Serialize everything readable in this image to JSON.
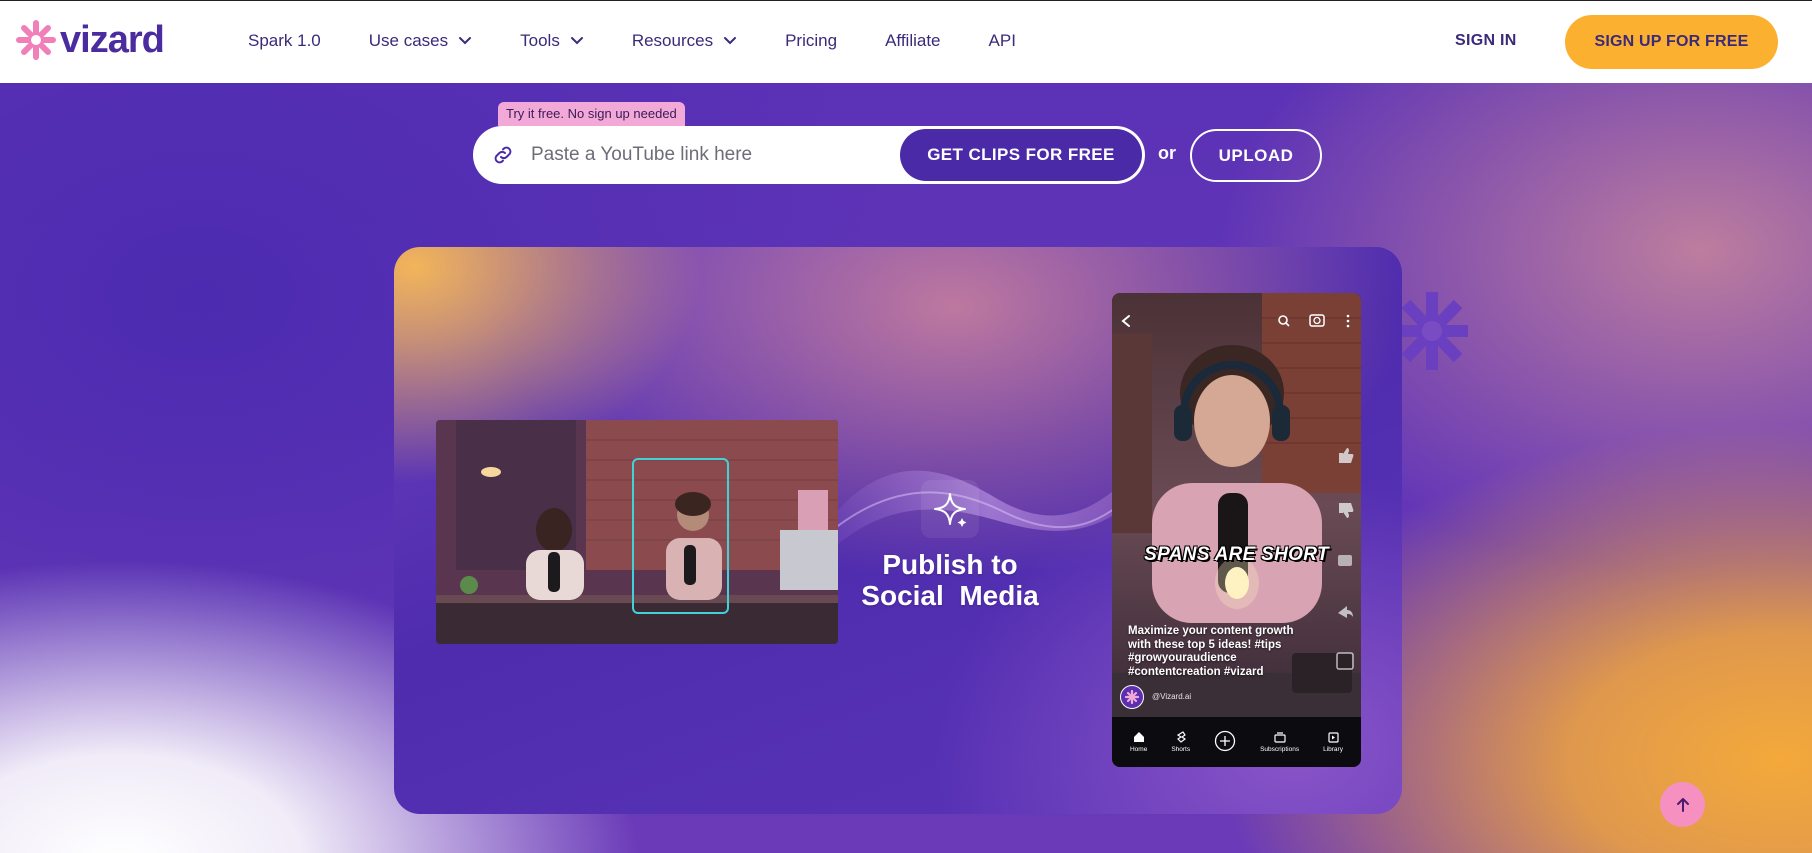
{
  "brand": {
    "name": "vizard"
  },
  "nav": {
    "items": [
      {
        "label": "Spark 1.0",
        "has_dropdown": false
      },
      {
        "label": "Use cases",
        "has_dropdown": true
      },
      {
        "label": "Tools",
        "has_dropdown": true
      },
      {
        "label": "Resources",
        "has_dropdown": true
      },
      {
        "label": "Pricing",
        "has_dropdown": false
      },
      {
        "label": "Affiliate",
        "has_dropdown": false
      },
      {
        "label": "API",
        "has_dropdown": false
      }
    ],
    "signin_label": "SIGN IN",
    "signup_label": "SIGN UP FOR FREE"
  },
  "hero": {
    "tag": "Try it free. No sign up needed",
    "input_placeholder": "Paste a YouTube link here",
    "input_value": "",
    "cta_label": "GET CLIPS FOR FREE",
    "or_label": "or",
    "upload_label": "UPLOAD"
  },
  "demo": {
    "publish_line1": "Publish to",
    "publish_line2": "Social  Media",
    "phone": {
      "caption_big": "SPANS ARE SHORT",
      "description": "Maximize your content growth with these top 5 ideas! #tips #growyouraudience #contentcreation #vizard",
      "handle": "@Vizard.ai",
      "tabs": [
        "Home",
        "Shorts",
        "",
        "Subscriptions",
        "Library"
      ]
    }
  },
  "colors": {
    "brand_purple": "#4b2aa8",
    "accent_orange": "#fbb02f",
    "logo_pink": "#f17fb8",
    "tag_pink": "#f3a9d8"
  }
}
